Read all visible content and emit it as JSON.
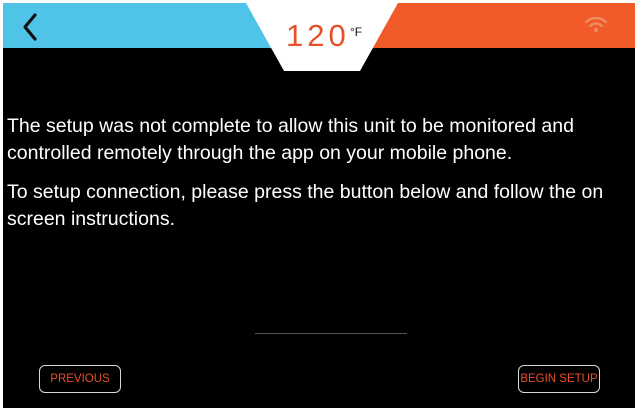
{
  "header": {
    "temperature_value": "120",
    "temperature_unit": "°F",
    "back_icon": "chevron-left-icon",
    "wifi_icon": "wifi-icon",
    "colors": {
      "left_bar": "#4fc3e8",
      "right_bar": "#ef5a28",
      "temperature_text": "#e8502a"
    }
  },
  "body": {
    "message_1": "The setup was not complete to allow this unit to be monitored and controlled remotely through the app on your mobile phone.",
    "message_2": "To setup connection, please press the button below and follow the on screen instructions."
  },
  "footer": {
    "previous_label": "PREVIOUS",
    "begin_setup_label": "BEGIN SETUP",
    "button_text_color": "#e94e27"
  }
}
